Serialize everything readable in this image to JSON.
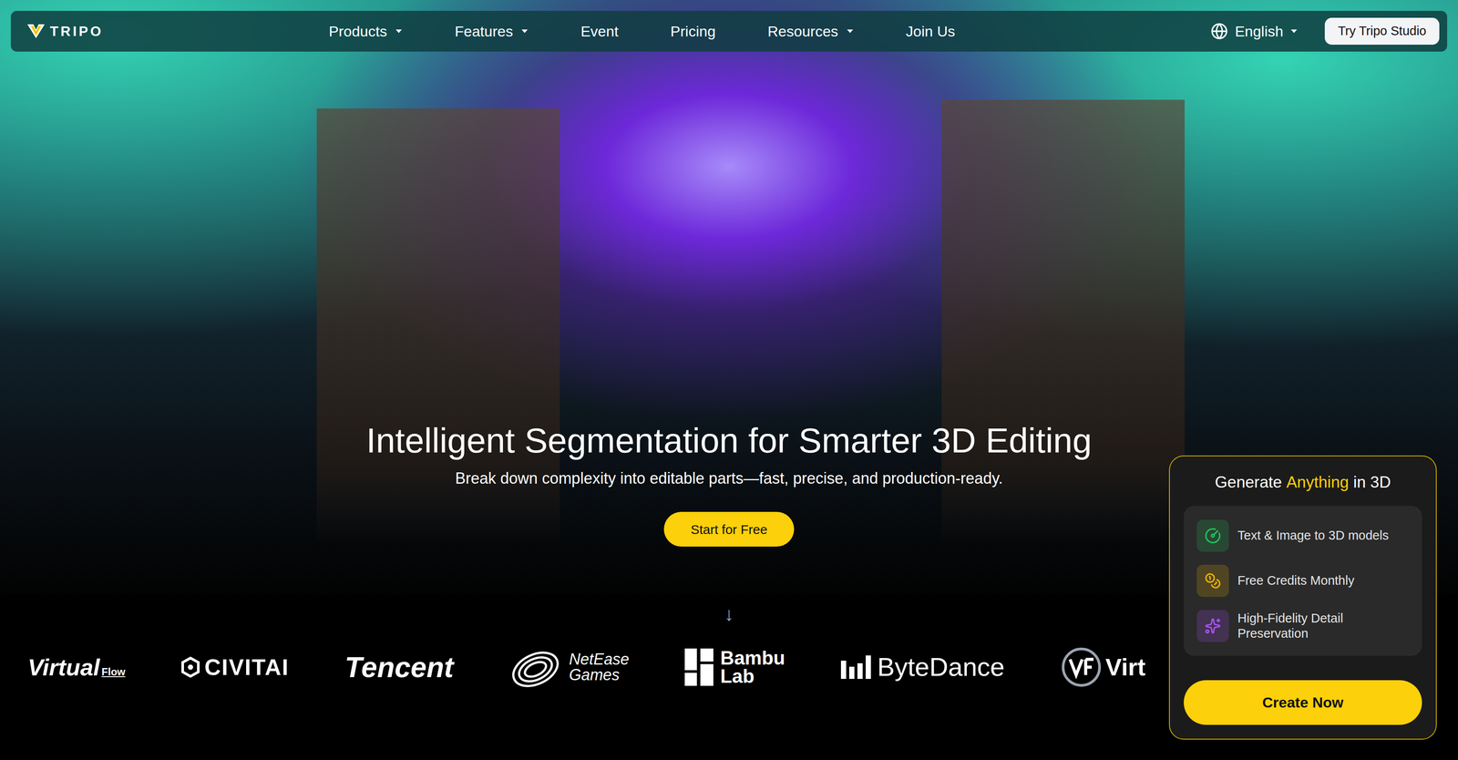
{
  "nav": {
    "logo": "TRIPO",
    "items": [
      {
        "label": "Products",
        "has_menu": true
      },
      {
        "label": "Features",
        "has_menu": true
      },
      {
        "label": "Event",
        "has_menu": false
      },
      {
        "label": "Pricing",
        "has_menu": false
      },
      {
        "label": "Resources",
        "has_menu": true
      },
      {
        "label": "Join Us",
        "has_menu": false
      }
    ],
    "language": {
      "label": "English",
      "has_menu": true
    },
    "cta": "Try Tripo Studio"
  },
  "hero": {
    "title": "Intelligent Segmentation for Smarter 3D Editing",
    "subtitle": "Break down complexity into editable parts—fast, precise, and production-ready.",
    "cta": "Start for Free",
    "scroll_hint": "↓"
  },
  "partners": [
    {
      "kind": "virtualflow",
      "lines": [
        "Virtual",
        "Flow"
      ]
    },
    {
      "kind": "civitai",
      "lines": [
        "CIVITAI"
      ]
    },
    {
      "kind": "tencent",
      "lines": [
        "Tencent"
      ]
    },
    {
      "kind": "netease",
      "lines": [
        "NetEase",
        "Games"
      ]
    },
    {
      "kind": "bambu",
      "lines": [
        "Bambu",
        "Lab"
      ]
    },
    {
      "kind": "bytedance",
      "lines": [
        "ByteDance"
      ]
    },
    {
      "kind": "vf",
      "lines": [
        "Virt"
      ]
    }
  ],
  "promo_card": {
    "title_start": "Generate",
    "title_highlight": "Anything",
    "title_end": "in 3D",
    "features": [
      {
        "label": "Text & Image to 3D models",
        "color": "#22c55e"
      },
      {
        "label": "Free Credits Monthly",
        "color": "#eab308"
      },
      {
        "label": "High-Fidelity Detail Preservation",
        "color": "#a855f7"
      }
    ],
    "cta": "Create Now"
  }
}
